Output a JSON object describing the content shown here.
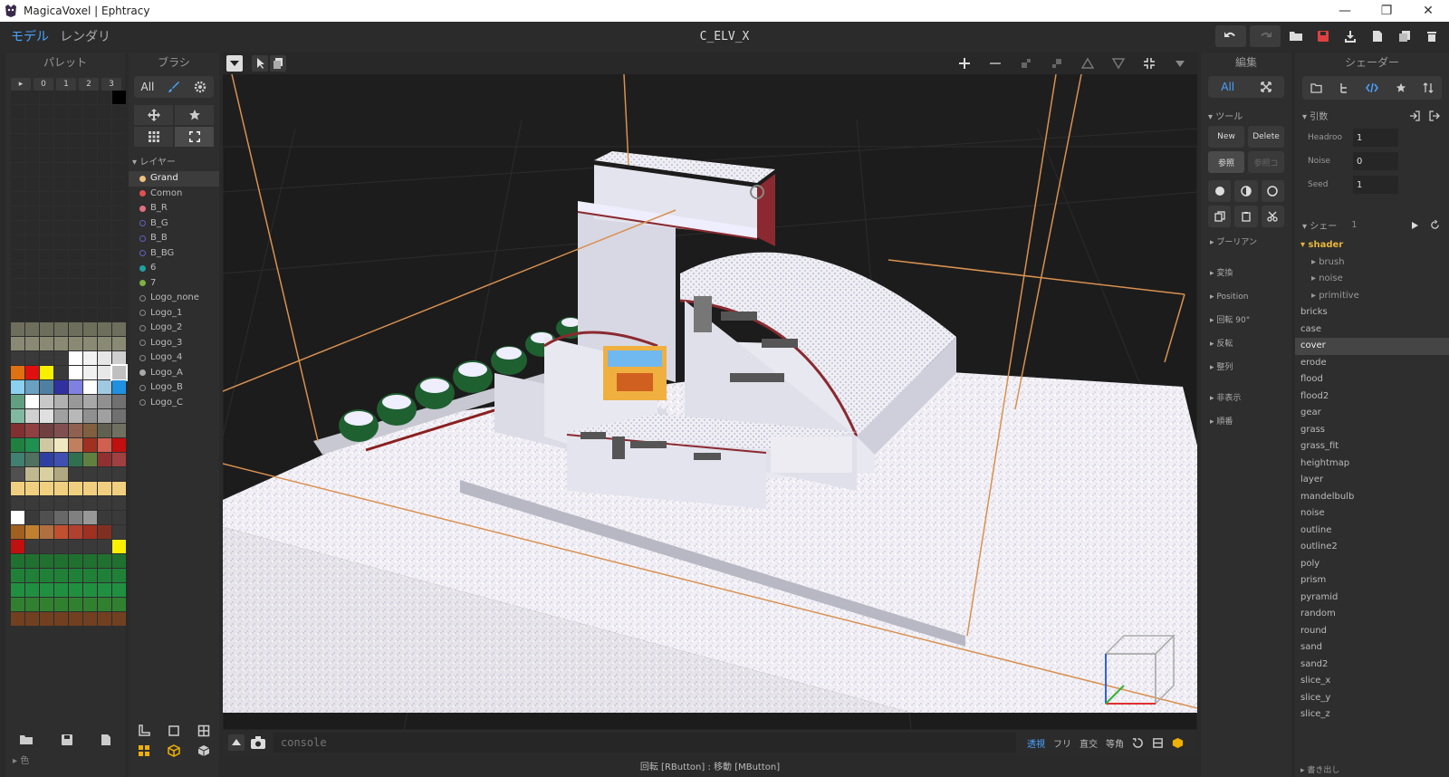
{
  "window": {
    "title": "MagicaVoxel | Ephtracy"
  },
  "menu": {
    "model": "モデル",
    "render": "レンダリ",
    "doc_title": "C_ELV_X"
  },
  "palette": {
    "header": "パレット",
    "tabs": [
      "0",
      "1",
      "2",
      "3"
    ],
    "footer_label": "▸ 色",
    "colors": [
      "#2a2a2a",
      "#2a2a2a",
      "#2a2a2a",
      "#2a2a2a",
      "#2a2a2a",
      "#2a2a2a",
      "#2a2a2a",
      "#000000",
      "#2a2a2a",
      "#2a2a2a",
      "#2a2a2a",
      "#2a2a2a",
      "#2a2a2a",
      "#2a2a2a",
      "#2a2a2a",
      "#2a2a2a",
      "#2a2a2a",
      "#2a2a2a",
      "#2a2a2a",
      "#2a2a2a",
      "#2a2a2a",
      "#2a2a2a",
      "#2a2a2a",
      "#2a2a2a",
      "#2a2a2a",
      "#2a2a2a",
      "#2a2a2a",
      "#2a2a2a",
      "#2a2a2a",
      "#2a2a2a",
      "#2a2a2a",
      "#2a2a2a",
      "#2a2a2a",
      "#2a2a2a",
      "#2a2a2a",
      "#2a2a2a",
      "#2a2a2a",
      "#2a2a2a",
      "#2a2a2a",
      "#2a2a2a",
      "#2a2a2a",
      "#2a2a2a",
      "#2a2a2a",
      "#2a2a2a",
      "#2a2a2a",
      "#2a2a2a",
      "#2a2a2a",
      "#2a2a2a",
      "#2a2a2a",
      "#2a2a2a",
      "#2a2a2a",
      "#2a2a2a",
      "#2a2a2a",
      "#2a2a2a",
      "#2a2a2a",
      "#2a2a2a",
      "#2a2a2a",
      "#2a2a2a",
      "#2a2a2a",
      "#2a2a2a",
      "#2a2a2a",
      "#2a2a2a",
      "#2a2a2a",
      "#2a2a2a",
      "#2a2a2a",
      "#2a2a2a",
      "#2a2a2a",
      "#2a2a2a",
      "#2a2a2a",
      "#2a2a2a",
      "#2a2a2a",
      "#2a2a2a",
      "#2a2a2a",
      "#2a2a2a",
      "#2a2a2a",
      "#2a2a2a",
      "#2a2a2a",
      "#2a2a2a",
      "#2a2a2a",
      "#2a2a2a",
      "#2a2a2a",
      "#2a2a2a",
      "#2a2a2a",
      "#2a2a2a",
      "#2a2a2a",
      "#2a2a2a",
      "#2a2a2a",
      "#2a2a2a",
      "#2a2a2a",
      "#2a2a2a",
      "#2a2a2a",
      "#2a2a2a",
      "#2a2a2a",
      "#2a2a2a",
      "#2a2a2a",
      "#2a2a2a",
      "#2a2a2a",
      "#2a2a2a",
      "#2a2a2a",
      "#2a2a2a",
      "#2a2a2a",
      "#2a2a2a",
      "#2a2a2a",
      "#2a2a2a",
      "#2a2a2a",
      "#2a2a2a",
      "#2a2a2a",
      "#2a2a2a",
      "#2a2a2a",
      "#2a2a2a",
      "#2a2a2a",
      "#2a2a2a",
      "#2a2a2a",
      "#2a2a2a",
      "#2a2a2a",
      "#2a2a2a",
      "#2a2a2a",
      "#2a2a2a",
      "#2a2a2a",
      "#2a2a2a",
      "#2a2a2a",
      "#2a2a2a",
      "#2a2a2a",
      "#2a2a2a",
      "#2a2a2a",
      "#2a2a2a",
      "#2a2a2a",
      "#2a2a2a",
      "#6e6e5c",
      "#6e6e5c",
      "#6e6e5c",
      "#6e6e5c",
      "#6e6e5c",
      "#6e6e5c",
      "#6e6e5c",
      "#6e6e5c",
      "#8a8a74",
      "#8a8a74",
      "#8a8a74",
      "#8a8a74",
      "#8a8a74",
      "#8a8a74",
      "#8a8a74",
      "#8a8a74",
      "#3a3a3a",
      "#3a3a3a",
      "#3a3a3a",
      "#3a3a3a",
      "#ffffff",
      "#f2f2f2",
      "#e6e6e6",
      "#cfcfcf",
      "#e07010",
      "#e01010",
      "#f8f000",
      "#3a3a3a",
      "#ffffff",
      "#f0f0f0",
      "#e8e8e8",
      "#c0c0c0",
      "#8cd0f0",
      "#6aa0c0",
      "#5080a0",
      "#3030a0",
      "#8080e0",
      "#ffffff",
      "#a0c8e0",
      "#2090e0",
      "#60a080",
      "#ffffff",
      "#c8c8c8",
      "#b0b0b0",
      "#989898",
      "#a8a8a8",
      "#909090",
      "#707070",
      "#80b8a0",
      "#d0d0d0",
      "#e0e0e0",
      "#a0a0a0",
      "#b8b8b8",
      "#909090",
      "#a0a0a0",
      "#707070",
      "#803030",
      "#904040",
      "#704040",
      "#805050",
      "#906050",
      "#806040",
      "#606050",
      "#707060",
      "#208040",
      "#209050",
      "#d0c8a0",
      "#f0e8c0",
      "#c08060",
      "#a03020",
      "#d06050",
      "#c01010",
      "#408070",
      "#507060",
      "#3040a0",
      "#4050b0",
      "#307050",
      "#608040",
      "#903030",
      "#a04040",
      "#505050",
      "#c0b890",
      "#d8d0a0",
      "#b0a880",
      "#3a3a3a",
      "#3a3a3a",
      "#3a3a3a",
      "#3a3a3a",
      "#f0d080",
      "#f0d080",
      "#f0d080",
      "#f0d080",
      "#f0d080",
      "#f0d080",
      "#f0d080",
      "#f0d080",
      "#3a3a3a",
      "#3a3a3a",
      "#3a3a3a",
      "#3a3a3a",
      "#3a3a3a",
      "#3a3a3a",
      "#3a3a3a",
      "#3a3a3a",
      "#ffffff",
      "#3a3a3a",
      "#505050",
      "#686868",
      "#808080",
      "#989898",
      "#3a3a3a",
      "#3a3a3a",
      "#a06020",
      "#c08030",
      "#b07040",
      "#c05030",
      "#b04030",
      "#a03020",
      "#803020",
      "#3a3a3a",
      "#c01010",
      "#3a3a3a",
      "#3a3a3a",
      "#3a3a3a",
      "#3a3a3a",
      "#3a3a3a",
      "#3a3a3a",
      "#f8f000",
      "#207030",
      "#207030",
      "#207030",
      "#207030",
      "#207030",
      "#207030",
      "#207030",
      "#207030",
      "#208038",
      "#208038",
      "#208038",
      "#208038",
      "#208038",
      "#208038",
      "#208038",
      "#208038",
      "#209040",
      "#209040",
      "#209040",
      "#209040",
      "#209040",
      "#209040",
      "#209040",
      "#209040",
      "#308030",
      "#308030",
      "#308030",
      "#308030",
      "#308030",
      "#308030",
      "#308030",
      "#308030",
      "#704020",
      "#704020",
      "#704020",
      "#704020",
      "#704020",
      "#704020",
      "#704020",
      "#704020"
    ]
  },
  "brush": {
    "header": "ブラシ",
    "filter_label": "All",
    "layers_title": "▾ レイヤー",
    "layers": [
      {
        "name": "Grand",
        "color": "#f0c080",
        "filled": true
      },
      {
        "name": "Comon",
        "color": "#e05050",
        "filled": true
      },
      {
        "name": "B_R",
        "color": "#e07080",
        "filled": true
      },
      {
        "name": "B_G",
        "color": "#6060c0",
        "filled": false
      },
      {
        "name": "B_B",
        "color": "#6060c0",
        "filled": false
      },
      {
        "name": "B_BG",
        "color": "#6060c0",
        "filled": false
      },
      {
        "name": "6",
        "color": "#20a0a0",
        "filled": true
      },
      {
        "name": "7",
        "color": "#80b040",
        "filled": true
      },
      {
        "name": "Logo_none",
        "color": "#888888",
        "filled": false
      },
      {
        "name": "Logo_1",
        "color": "#888888",
        "filled": false
      },
      {
        "name": "Logo_2",
        "color": "#888888",
        "filled": false
      },
      {
        "name": "Logo_3",
        "color": "#888888",
        "filled": false
      },
      {
        "name": "Logo_4",
        "color": "#888888",
        "filled": false
      },
      {
        "name": "Logo_A",
        "color": "#aaaaaa",
        "filled": true
      },
      {
        "name": "Logo_B",
        "color": "#888888",
        "filled": false
      },
      {
        "name": "Logo_C",
        "color": "#888888",
        "filled": false
      }
    ]
  },
  "edit": {
    "header": "編集",
    "filter_label": "All",
    "tools_title": "▾ ツール",
    "new_label": "New",
    "delete_label": "Delete",
    "ref_label": "参照",
    "ref_copy_label": "参照コ",
    "boolean_label": "▸ ブーリアン",
    "sections": [
      "▸ 変換",
      "▸ Position",
      "▸ 回転 90°",
      "▸ 反転",
      "▸ 整列"
    ],
    "sections2": [
      "▸ 非表示",
      "▸ 順番"
    ]
  },
  "shader": {
    "header": "シェーダー",
    "args_title": "▾ 引数",
    "args": [
      {
        "label": "Headroo",
        "value": "1"
      },
      {
        "label": "Noise",
        "value": "0"
      },
      {
        "label": "Seed",
        "value": "1"
      }
    ],
    "list_title": "▾ シェー",
    "list_count": "1",
    "folder": "▾ shader",
    "children": [
      "▸ brush",
      "▸ noise",
      "▸ primitive"
    ],
    "items": [
      "bricks",
      "case",
      "cover",
      "erode",
      "flood",
      "flood2",
      "gear",
      "grass",
      "grass_fit",
      "heightmap",
      "layer",
      "mandelbulb",
      "noise",
      "outline",
      "outline2",
      "poly",
      "prism",
      "pyramid",
      "random",
      "round",
      "sand",
      "sand2",
      "slice_x",
      "slice_y",
      "slice_z"
    ],
    "selected": "cover",
    "export_label": "▸ 書き出し"
  },
  "console": {
    "placeholder": "console",
    "modes": [
      "透視",
      "フリ",
      "直交",
      "等角"
    ],
    "active_mode": "透視",
    "status": "回転 [RButton] : 移動 [MButton]"
  }
}
